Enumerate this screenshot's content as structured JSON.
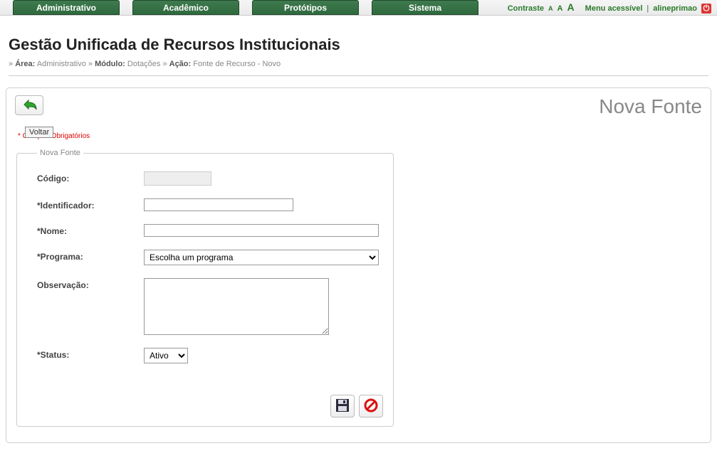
{
  "nav": {
    "items": [
      "Administrativo",
      "Acadêmico",
      "Protótipos",
      "Sistema"
    ]
  },
  "tools": {
    "contrast": "Contraste",
    "a1": "A",
    "a2": "A",
    "a3": "A",
    "menu_acc": "Menu acessível",
    "user": "alineprimao"
  },
  "header": {
    "title": "Gestão Unificada de Recursos Institucionais",
    "bc_area_k": "Área:",
    "bc_area_v": "Administrativo",
    "bc_mod_k": "Módulo:",
    "bc_mod_v": "Dotações",
    "bc_act_k": "Ação:",
    "bc_act_v": "Fonte de Recurso - Novo"
  },
  "panel": {
    "title": "Nova Fonte",
    "back_tip": "Voltar",
    "required_note": "* Campos Obrigatórios",
    "legend": "Nova Fonte"
  },
  "form": {
    "codigo_label": "Código:",
    "ident_label": "*Identificador:",
    "nome_label": "*Nome:",
    "programa_label": "*Programa:",
    "programa_placeholder": "Escolha um programa",
    "obs_label": "Observação:",
    "status_label": "*Status:",
    "status_value": "Ativo"
  }
}
